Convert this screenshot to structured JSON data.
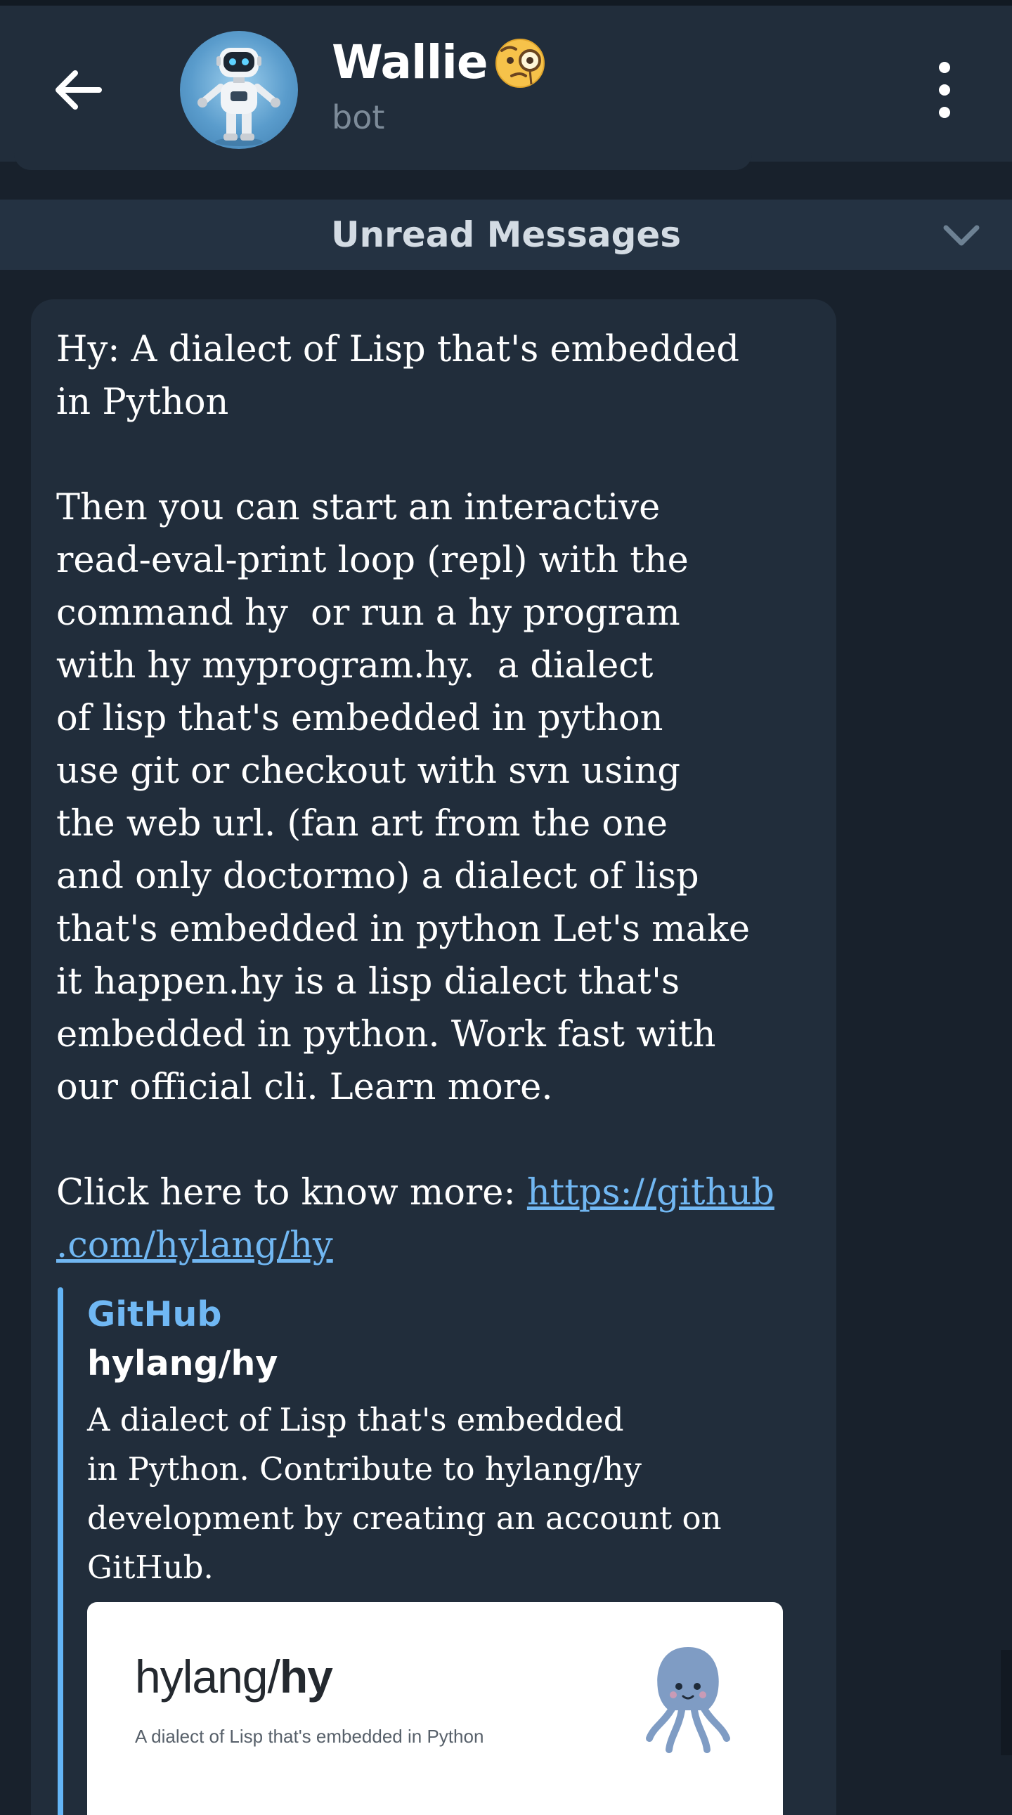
{
  "header": {
    "title": "Wallie",
    "title_emoji": "face-with-monocle",
    "subtitle": "bot",
    "avatar": "robot-avatar"
  },
  "unread_divider": {
    "label": "Unread Messages"
  },
  "message": {
    "text_before_link": "Hy: A dialect of Lisp that's embedded\nin Python\n\nThen you can start an interactive\nread-eval-print loop (repl) with the\ncommand hy  or run a hy program\nwith hy myprogram.hy.  a dialect\nof lisp that's embedded in python\nuse git or checkout with svn using\nthe web url. (fan art from the one\nand only doctormo) a dialect of lisp\nthat's embedded in python Let's make\nit happen.hy is a lisp dialect that's\nembedded in python. Work fast with\nour official cli. Learn more.\n\nClick here to know more: ",
    "link_text": "https://github.com/hylang/hy",
    "link_text_part1": "https://github",
    "link_text_part2": ".com/hylang/hy"
  },
  "link_preview": {
    "site_name": "GitHub",
    "title": "hylang/hy",
    "description": "A dialect of Lisp that's embedded\nin Python. Contribute to hylang/hy\ndevelopment by creating an account on\nGitHub.",
    "image": {
      "repo_owner": "hylang/",
      "repo_name": "hy",
      "description": "A dialect of Lisp that's embedded in Python",
      "logo": "hy-squid-logo"
    }
  },
  "colors": {
    "header_bg": "#212d3b",
    "chat_bg": "#18212c",
    "bubble_bg": "#212d3b",
    "link": "#71b7f2",
    "accent": "#64b5f6"
  }
}
